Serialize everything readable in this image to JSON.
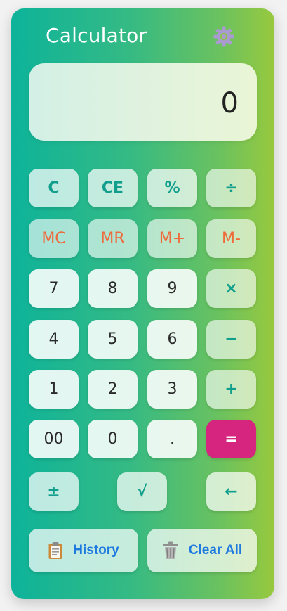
{
  "app": {
    "title": "Calculator"
  },
  "display": {
    "value": "0"
  },
  "icons": {
    "settings": "gear-icon",
    "history": "clipboard-icon",
    "clear_all": "trash-icon"
  },
  "colors": {
    "accent": "#119e8c",
    "memory": "#ef6a3a",
    "equals": "#d6257f",
    "link": "#1f7ae0"
  },
  "buttons": {
    "clear": "C",
    "clear_entry": "CE",
    "percent": "%",
    "divide": "÷",
    "mc": "MC",
    "mr": "MR",
    "m_plus": "M+",
    "m_minus": "M-",
    "seven": "7",
    "eight": "8",
    "nine": "9",
    "multiply": "×",
    "four": "4",
    "five": "5",
    "six": "6",
    "subtract": "−",
    "one": "1",
    "two": "2",
    "three": "3",
    "add": "+",
    "double_zero": "00",
    "zero": "0",
    "decimal": ".",
    "equals": "=",
    "plus_minus": "±",
    "sqrt": "√",
    "backspace": "←"
  },
  "actions": {
    "history": "History",
    "clear_all": "Clear All"
  }
}
